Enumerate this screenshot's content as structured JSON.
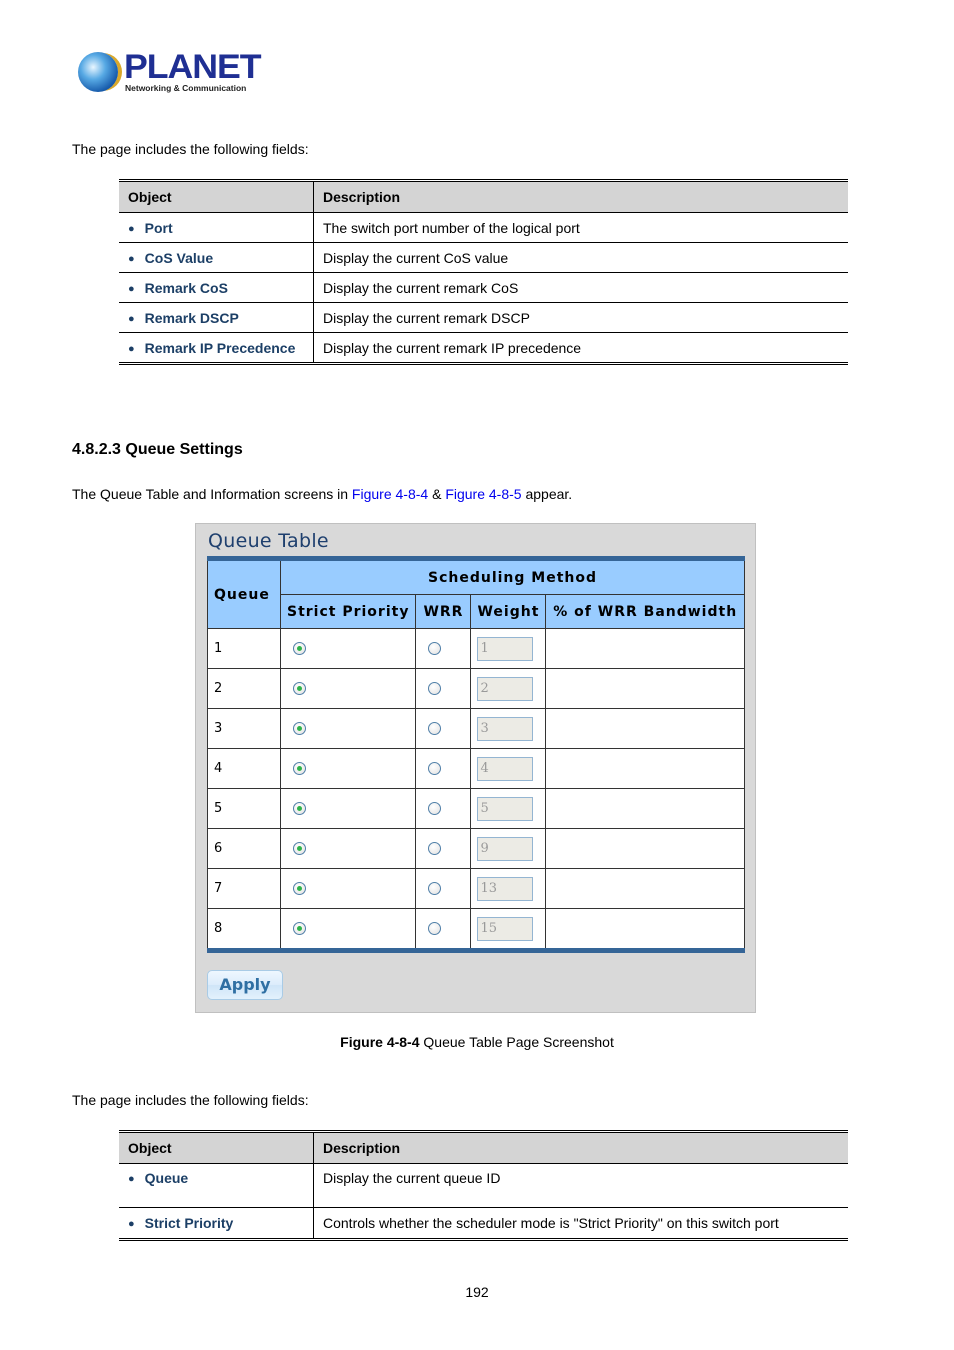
{
  "logo": {
    "brand": "PLANET",
    "tagline": "Networking & Communication"
  },
  "intro_text_1": "The page includes the following fields:",
  "table1": {
    "headers": [
      "Object",
      "Description"
    ],
    "rows": [
      {
        "object": "Port",
        "description": "The switch port number of the logical port"
      },
      {
        "object": "CoS Value",
        "description": "Display the current CoS value"
      },
      {
        "object": "Remark CoS",
        "description": "Display the current remark CoS"
      },
      {
        "object": "Remark DSCP",
        "description": "Display the current remark DSCP"
      },
      {
        "object": "Remark IP Precedence",
        "description": "Display the current remark IP precedence"
      }
    ]
  },
  "section": {
    "heading": "4.8.2.3 Queue Settings",
    "body_prefix": "The Queue Table and Information screens in ",
    "link1": "Figure 4-8-4",
    "body_mid": " & ",
    "link2": "Figure 4-8-5",
    "body_suffix": " appear."
  },
  "queue_table": {
    "title": "Queue Table",
    "headers": {
      "queue": "Queue",
      "scheduling_method": "Scheduling Method",
      "strict_priority": "Strict Priority",
      "wrr": "WRR",
      "weight": "Weight",
      "wrr_bandwidth": "% of WRR Bandwidth"
    },
    "rows": [
      {
        "queue": "1",
        "strict_priority": true,
        "wrr": false,
        "weight": "1",
        "bandwidth": ""
      },
      {
        "queue": "2",
        "strict_priority": true,
        "wrr": false,
        "weight": "2",
        "bandwidth": ""
      },
      {
        "queue": "3",
        "strict_priority": true,
        "wrr": false,
        "weight": "3",
        "bandwidth": ""
      },
      {
        "queue": "4",
        "strict_priority": true,
        "wrr": false,
        "weight": "4",
        "bandwidth": ""
      },
      {
        "queue": "5",
        "strict_priority": true,
        "wrr": false,
        "weight": "5",
        "bandwidth": ""
      },
      {
        "queue": "6",
        "strict_priority": true,
        "wrr": false,
        "weight": "9",
        "bandwidth": ""
      },
      {
        "queue": "7",
        "strict_priority": true,
        "wrr": false,
        "weight": "13",
        "bandwidth": ""
      },
      {
        "queue": "8",
        "strict_priority": true,
        "wrr": false,
        "weight": "15",
        "bandwidth": ""
      }
    ],
    "apply_label": "Apply"
  },
  "caption": {
    "label": "Figure 4-8-4",
    "text": " Queue Table Page Screenshot"
  },
  "intro_text_2": "The page includes the following fields:",
  "table2": {
    "headers": [
      "Object",
      "Description"
    ],
    "rows": [
      {
        "object": "Queue",
        "description": "Display the current queue ID"
      },
      {
        "object": "Strict Priority",
        "description": "Controls whether the scheduler mode is \"Strict Priority\" on this switch port"
      }
    ]
  },
  "page_number": "192",
  "colors": {
    "header_blue": "#99ccff",
    "table_border_blue": "#356597",
    "object_text": "#1c3f66",
    "link": "#0000ee"
  }
}
